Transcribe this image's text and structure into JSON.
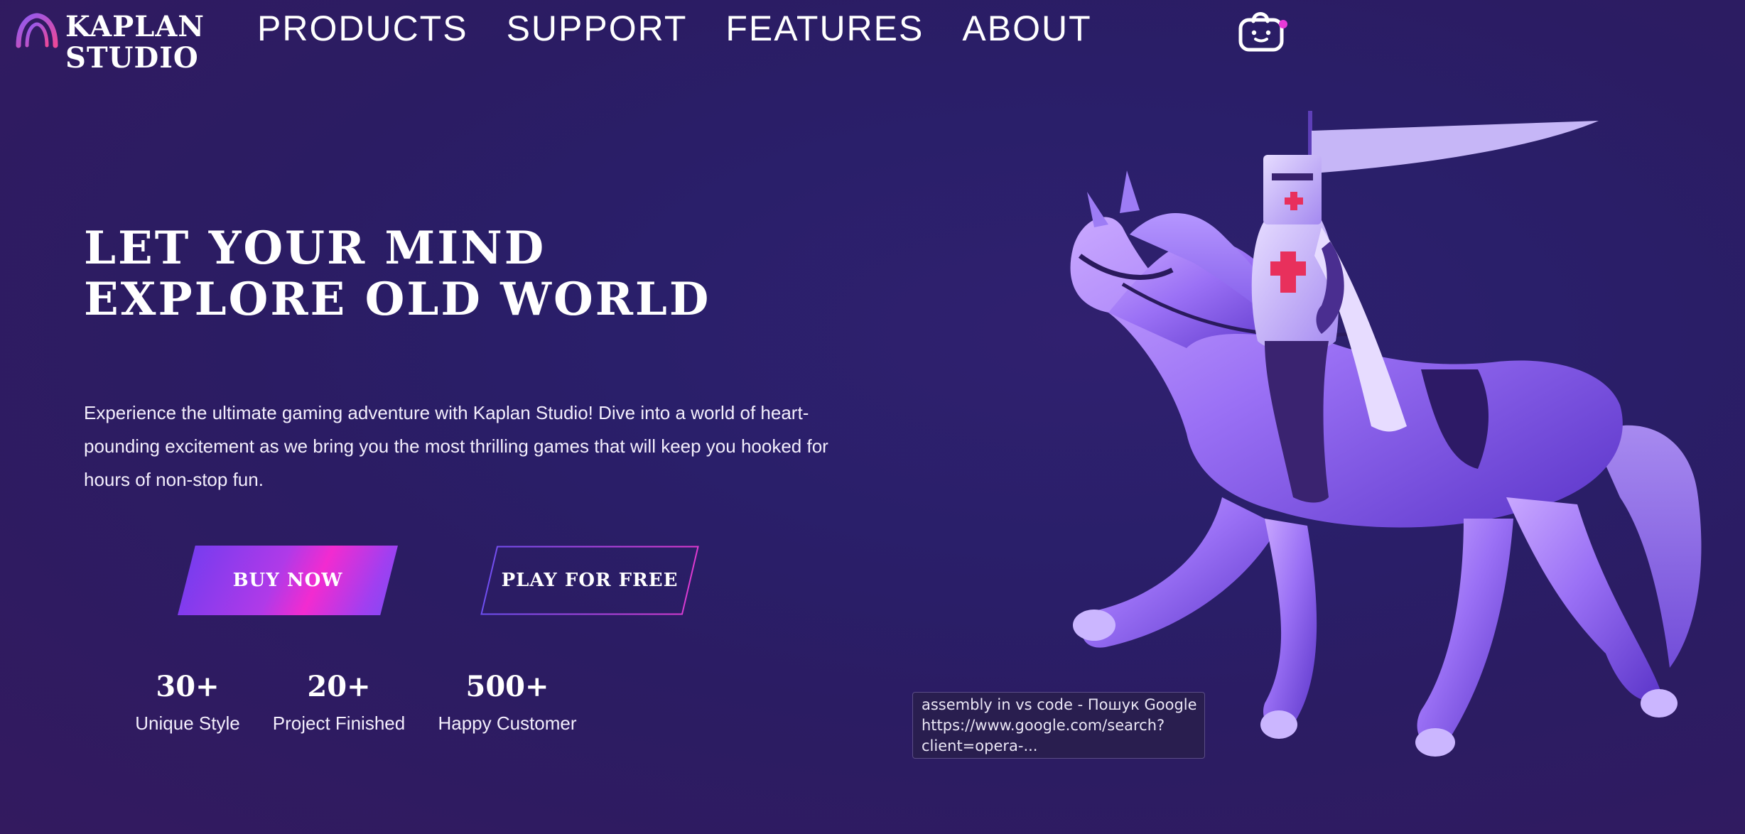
{
  "brand": {
    "line1": "KAPLAN",
    "line2": "STUDIO",
    "logo_icon": "arch-logo-icon"
  },
  "nav": {
    "items": [
      {
        "label": "PRODUCTS"
      },
      {
        "label": "SUPPORT"
      },
      {
        "label": "FEATURES"
      },
      {
        "label": "ABOUT"
      }
    ],
    "cart_icon": "shopping-bag-icon"
  },
  "hero": {
    "title_line1": "LET YOUR MIND",
    "title_line2": "EXPLORE OLD WORLD",
    "description": "Experience the ultimate gaming adventure with Kaplan Studio! Dive into a world of heart-pounding excitement as we bring you the most thrilling games that will keep you hooked for hours of non-stop fun."
  },
  "buttons": {
    "buy": "BUY NOW",
    "play": "PLAY FOR FREE"
  },
  "stats": [
    {
      "value": "30+",
      "label": "Unique Style"
    },
    {
      "value": "20+",
      "label": "Project Finished"
    },
    {
      "value": "500+",
      "label": "Happy Customer"
    }
  ],
  "tooltip": {
    "line1": "assembly in vs code - Пошук Google",
    "line2": "https://www.google.com/search?",
    "line3": "client=opera-..."
  },
  "colors": {
    "background": "#2b1f66",
    "accent_pink": "#f22bd0",
    "accent_purple": "#7c4cf5",
    "cart_badge": "#e83ad8"
  }
}
